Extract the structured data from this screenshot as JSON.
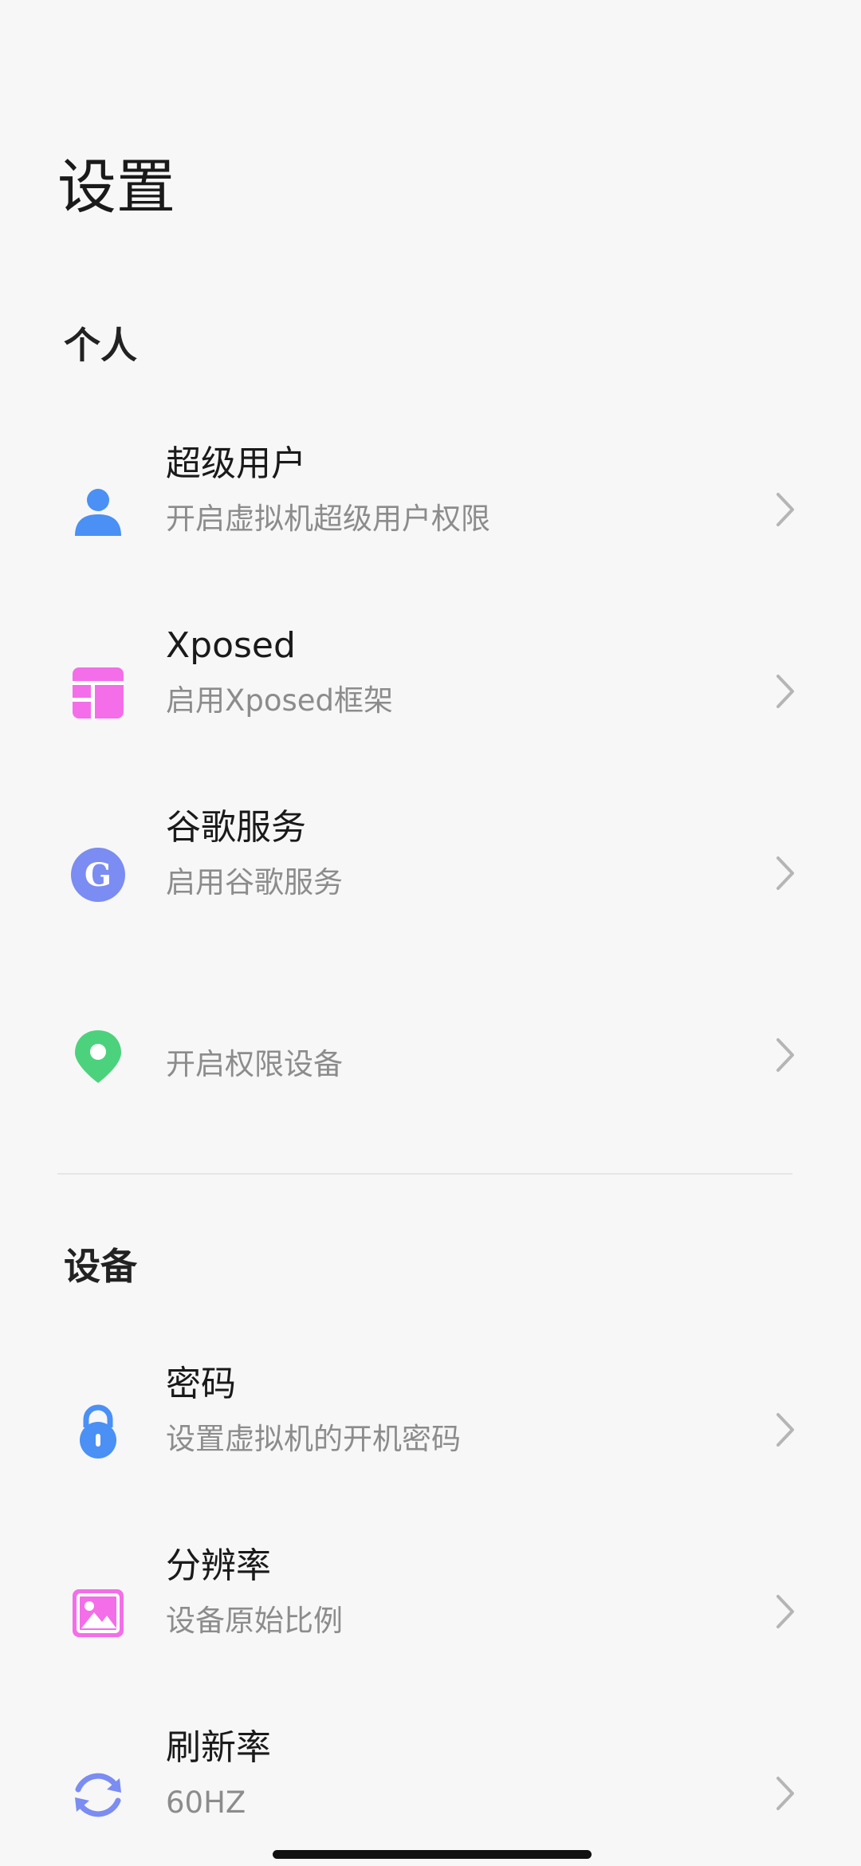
{
  "page": {
    "title": "设置"
  },
  "sections": {
    "personal": {
      "header": "个人",
      "items": [
        {
          "title": "超级用户",
          "subtitle": "开启虚拟机超级用户权限",
          "icon": "user-icon",
          "color": "#4a90f5"
        },
        {
          "title": "Xposed",
          "subtitle": "启用Xposed框架",
          "icon": "layout-grid-icon",
          "color": "#f36ee8"
        },
        {
          "title": "谷歌服务",
          "subtitle": "启用谷歌服务",
          "icon": "google-g-icon",
          "color": "#7b8cf2"
        },
        {
          "title": "",
          "subtitle": "开启权限设备",
          "icon": "location-pin-icon",
          "color": "#4cd27c"
        }
      ]
    },
    "device": {
      "header": "设备",
      "items": [
        {
          "title": "密码",
          "subtitle": "设置虚拟机的开机密码",
          "icon": "lock-icon",
          "color": "#4a90f5"
        },
        {
          "title": "分辨率",
          "subtitle": "设备原始比例",
          "icon": "image-icon",
          "color": "#f36ee8"
        },
        {
          "title": "刷新率",
          "subtitle": "60HZ",
          "icon": "refresh-icon",
          "color": "#7b8cf2"
        }
      ]
    }
  },
  "icons": {
    "chevron": "chevron-right-icon",
    "chevron_color": "#b5b5b5"
  }
}
